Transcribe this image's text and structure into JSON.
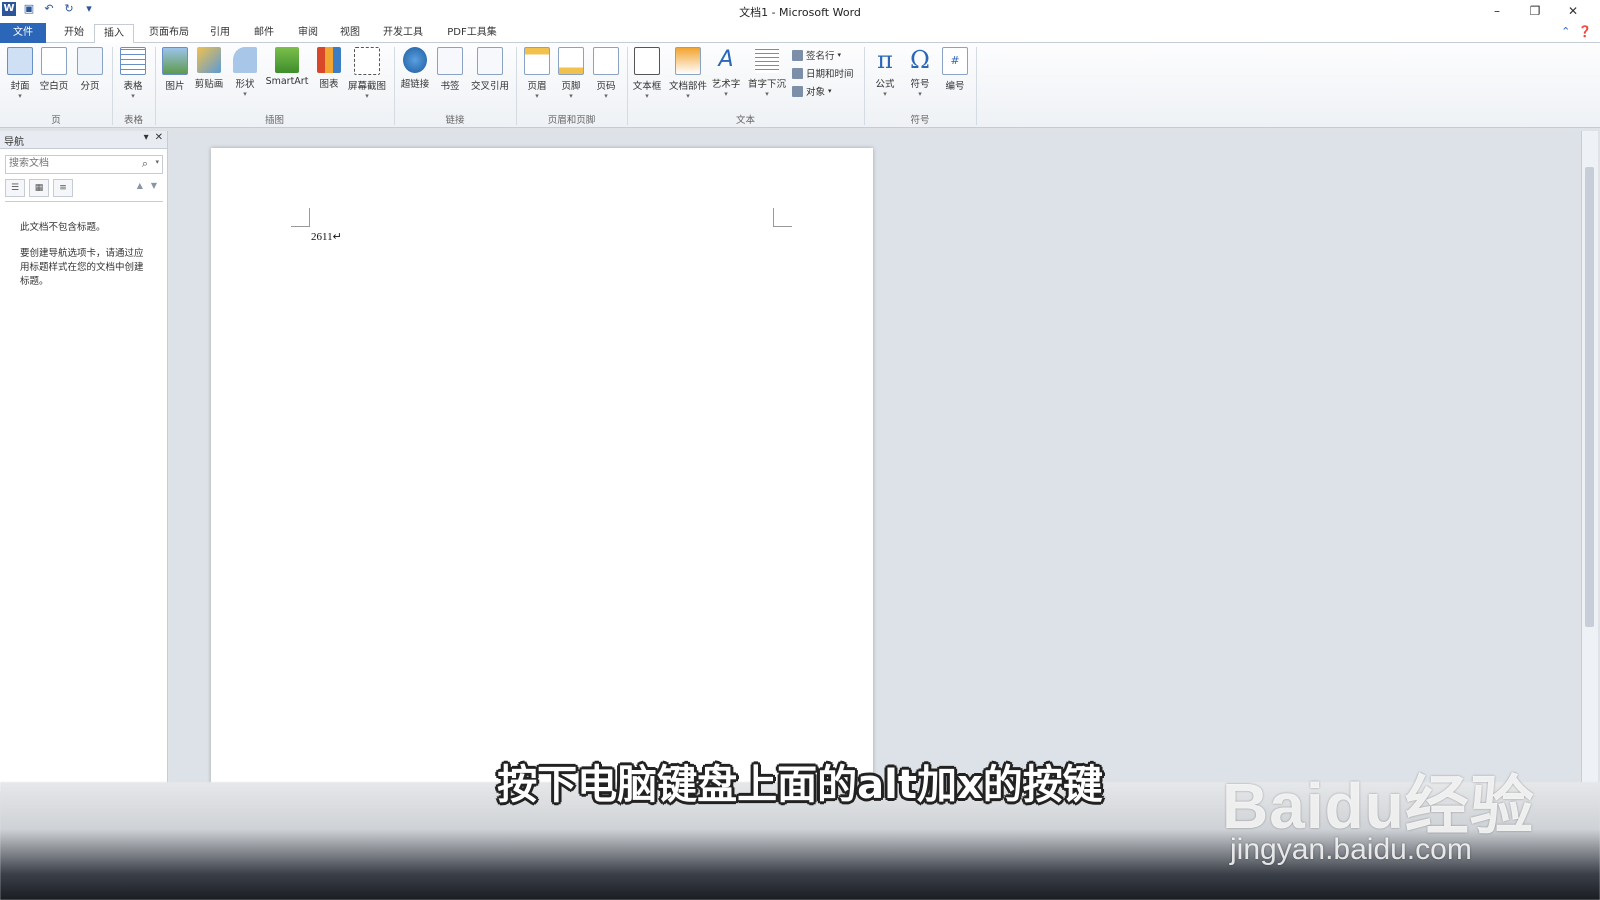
{
  "window": {
    "title": "文档1 - Microsoft Word",
    "app_icon": "W",
    "controls": {
      "minimize": "–",
      "restore": "❐",
      "close": "✕"
    }
  },
  "tabs": [
    {
      "label": "文件"
    },
    {
      "label": "开始"
    },
    {
      "label": "插入"
    },
    {
      "label": "页面布局"
    },
    {
      "label": "引用"
    },
    {
      "label": "邮件"
    },
    {
      "label": "审阅"
    },
    {
      "label": "视图"
    },
    {
      "label": "开发工具"
    },
    {
      "label": "PDF工具集"
    }
  ],
  "active_tab": "插入",
  "ribbon": {
    "buttons": [
      {
        "label": "封面"
      },
      {
        "label": "空白页"
      },
      {
        "label": "分页"
      },
      {
        "label": "表格"
      },
      {
        "label": "图片"
      },
      {
        "label": "剪贴画"
      },
      {
        "label": "形状"
      },
      {
        "label": "SmartArt"
      },
      {
        "label": "图表"
      },
      {
        "label": "屏幕截图"
      },
      {
        "label": "超链接"
      },
      {
        "label": "书签"
      },
      {
        "label": "交叉引用"
      },
      {
        "label": "页眉"
      },
      {
        "label": "页脚"
      },
      {
        "label": "页码"
      },
      {
        "label": "文本框"
      },
      {
        "label": "文档部件"
      },
      {
        "label": "艺术字"
      },
      {
        "label": "首字下沉"
      },
      {
        "label": "公式"
      },
      {
        "label": "符号"
      },
      {
        "label": "编号"
      }
    ],
    "small_buttons": [
      {
        "label": "签名行"
      },
      {
        "label": "日期和时间"
      },
      {
        "label": "对象"
      }
    ],
    "groups": [
      {
        "label": "页"
      },
      {
        "label": "表格"
      },
      {
        "label": "插图"
      },
      {
        "label": "链接"
      },
      {
        "label": "页眉和页脚"
      },
      {
        "label": "文本"
      },
      {
        "label": "符号"
      }
    ]
  },
  "nav_pane": {
    "title": "导航",
    "search_placeholder": "搜索文档",
    "message1": "此文档不包含标题。",
    "message2": "要创建导航选项卡，请通过应用标题样式在您的文档中创建标题。"
  },
  "document": {
    "text": "2611↵"
  },
  "subtitle": "按下电脑键盘上面的alt加x的按键",
  "watermark": {
    "brand": "Baidu经验",
    "url": "jingyan.baidu.com"
  }
}
